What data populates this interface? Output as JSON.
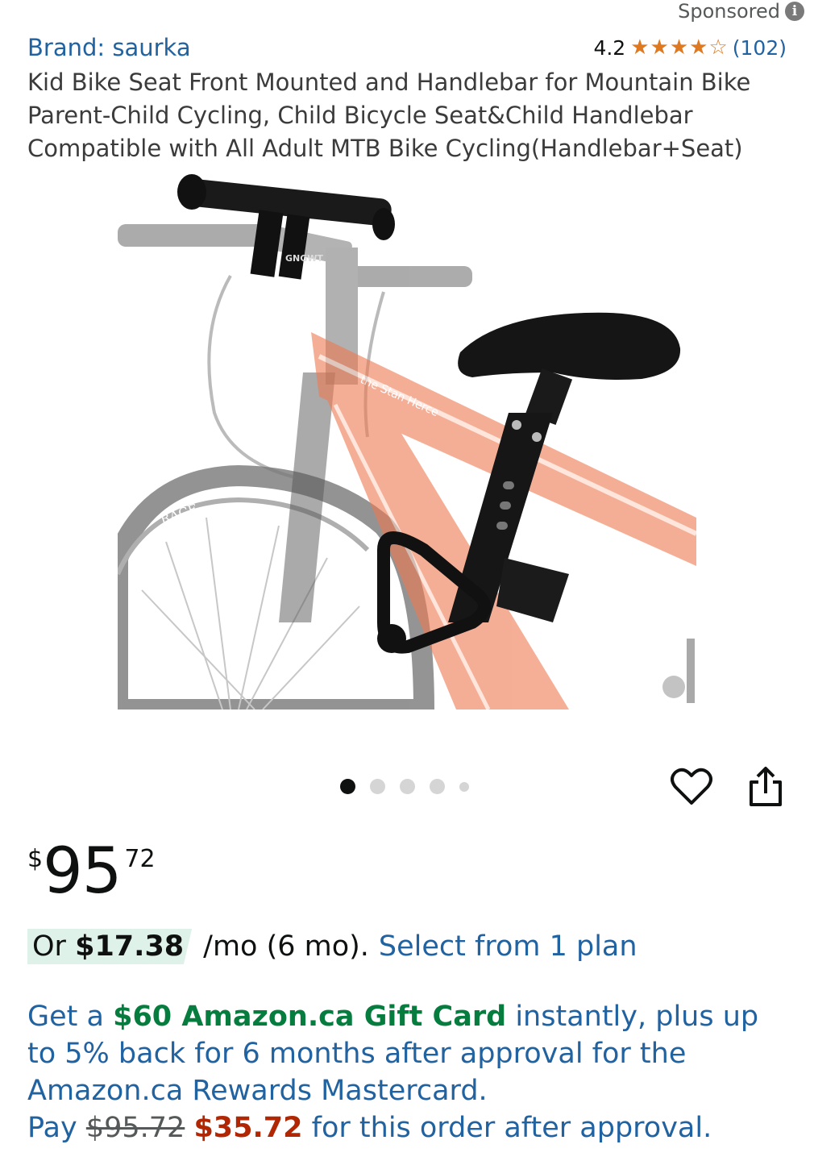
{
  "sponsored": {
    "label": "Sponsored"
  },
  "brand": {
    "label": "Brand: saurka"
  },
  "rating": {
    "value": "4.2",
    "stars": 4.2,
    "count": "(102)"
  },
  "title": "Kid Bike Seat Front Mounted and Handlebar for Mountain Bike Parent-Child Cycling, Child Bicycle Seat&Child Handlebar Compatible with All Adult MTB Bike Cycling(Handlebar+Seat)",
  "image_overlay_text": {
    "brand_mark": "GNGWT",
    "rim_text": "RACE",
    "frame_text": "the Stan Herce"
  },
  "carousel": {
    "total": 5,
    "active_index": 0
  },
  "price": {
    "symbol": "$",
    "whole": "95",
    "fraction": "72"
  },
  "monthly": {
    "prefix": "Or",
    "amount": "$17.38",
    "terms": "/mo (6 mo).",
    "link": "Select from 1 plan"
  },
  "promo": {
    "lead": "Get a",
    "gift": "$60 Amazon.ca Gift Card",
    "rest": "instantly, plus up to 5% back for 6 months after approval for the Amazon.ca Rewards Mastercard.",
    "pay_label": "Pay",
    "old_price": "$95.72",
    "new_price": "$35.72",
    "tail": "for this order after approval."
  },
  "colors": {
    "link": "#2162a1",
    "star": "#de7921",
    "green": "#067d3e",
    "red": "#b12704",
    "bike_frame": "#f07a52"
  }
}
